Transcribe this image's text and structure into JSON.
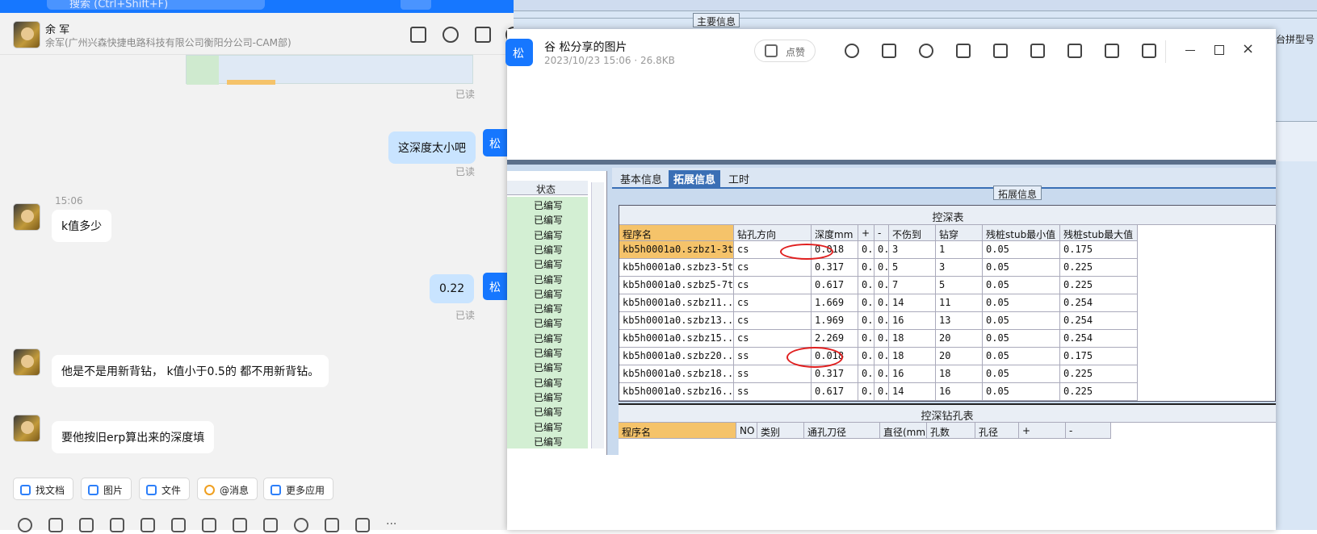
{
  "search": {
    "placeholder": "搜索 (Ctrl+Shift+F)"
  },
  "chat": {
    "contact_name": "余 军",
    "contact_sub": "余军(广州兴森快捷电路科技有限公司衡阳分公司-CAM部)",
    "messages": [
      {
        "from": "me",
        "text": "这深度太小吧",
        "status": "已读"
      },
      {
        "from": "other",
        "time": "15:06",
        "text": "k值多少"
      },
      {
        "from": "me",
        "text": "0.22",
        "status": "已读"
      },
      {
        "from": "other",
        "text": "他是不是用新背钻， k值小于0.5的 都不用新背钻。"
      },
      {
        "from": "other",
        "text": "要他按旧erp算出来的深度填"
      }
    ],
    "top_read": "已读",
    "my_avatar_char": "松",
    "toolbar": [
      "找文档",
      "图片",
      "文件",
      "@消息",
      "更多应用"
    ]
  },
  "viewer": {
    "avatar_char": "松",
    "title": "谷 松分享的图片",
    "meta": "2023/10/23 15:06 · 26.8KB",
    "like_label": "点赞",
    "bg_label_main": "主要信息",
    "bg_label_right": "台拼型号"
  },
  "screenshot": {
    "tabs": [
      "基本信息",
      "拓展信息",
      "工时"
    ],
    "group_label": "拓展信息",
    "status_header": "状态",
    "status_value": "已编写",
    "table_title": "控深表",
    "columns": [
      "程序名",
      "钻孔方向",
      "深度mm",
      "+",
      "-",
      "不伤到",
      "钻穿",
      "残桩stub最小值",
      "残桩stub最大值"
    ],
    "rows": [
      [
        "kb5h0001a0.szbz1-3t",
        "cs",
        "0.018",
        "0..",
        "0..",
        "3",
        "1",
        "0.05",
        "0.175"
      ],
      [
        "kb5h0001a0.szbz3-5t",
        "cs",
        "0.317",
        "0..",
        "0..",
        "5",
        "3",
        "0.05",
        "0.225"
      ],
      [
        "kb5h0001a0.szbz5-7t",
        "cs",
        "0.617",
        "0..",
        "0..",
        "7",
        "5",
        "0.05",
        "0.225"
      ],
      [
        "kb5h0001a0.szbz11...",
        "cs",
        "1.669",
        "0..",
        "0..",
        "14",
        "11",
        "0.05",
        "0.254"
      ],
      [
        "kb5h0001a0.szbz13...",
        "cs",
        "1.969",
        "0..",
        "0..",
        "16",
        "13",
        "0.05",
        "0.254"
      ],
      [
        "kb5h0001a0.szbz15...",
        "cs",
        "2.269",
        "0..",
        "0..",
        "18",
        "20",
        "0.05",
        "0.254"
      ],
      [
        "kb5h0001a0.szbz20...",
        "ss",
        "0.018",
        "0..",
        "0..",
        "18",
        "20",
        "0.05",
        "0.175"
      ],
      [
        "kb5h0001a0.szbz18...",
        "ss",
        "0.317",
        "0..",
        "0..",
        "16",
        "18",
        "0.05",
        "0.225"
      ],
      [
        "kb5h0001a0.szbz16...",
        "ss",
        "0.617",
        "0..",
        "0..",
        "14",
        "16",
        "0.05",
        "0.225"
      ]
    ],
    "table2_title": "控深钻孔表",
    "columns2": [
      "程序名",
      "NO",
      "类别",
      "通孔刀径",
      "直径(mm)",
      "孔数",
      "孔径",
      "+",
      "-"
    ]
  }
}
